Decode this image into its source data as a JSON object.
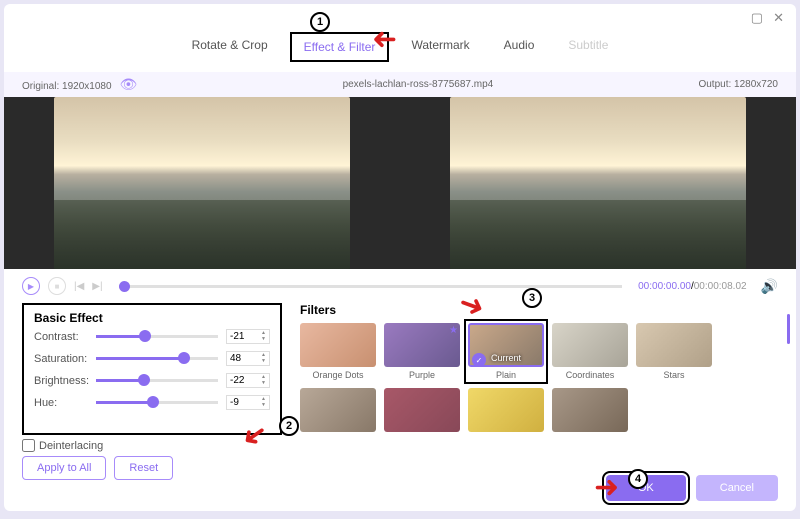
{
  "tabs": [
    "Rotate & Crop",
    "Effect & Filter",
    "Watermark",
    "Audio",
    "Subtitle"
  ],
  "info": {
    "original": "Original: 1920x1080",
    "filename": "pexels-lachlan-ross-8775687.mp4",
    "output": "Output: 1280x720"
  },
  "time": {
    "current": "00:00:00.00",
    "duration": "00:00:08.02"
  },
  "basic": {
    "title": "Basic Effect",
    "rows": [
      {
        "label": "Contrast:",
        "value": "-21",
        "pct": "40%"
      },
      {
        "label": "Saturation:",
        "value": "48",
        "pct": "72%"
      },
      {
        "label": "Brightness:",
        "value": "-22",
        "pct": "39%"
      },
      {
        "label": "Hue:",
        "value": "-9",
        "pct": "47%"
      }
    ]
  },
  "deinterlacing": "Deinterlacing",
  "apply_all": "Apply to All",
  "reset": "Reset",
  "filters_title": "Filters",
  "filters": [
    "Orange Dots",
    "Purple",
    "Plain",
    "Coordinates",
    "Stars",
    "",
    "",
    "",
    ""
  ],
  "current": "Current",
  "ok": "OK",
  "cancel": "Cancel"
}
